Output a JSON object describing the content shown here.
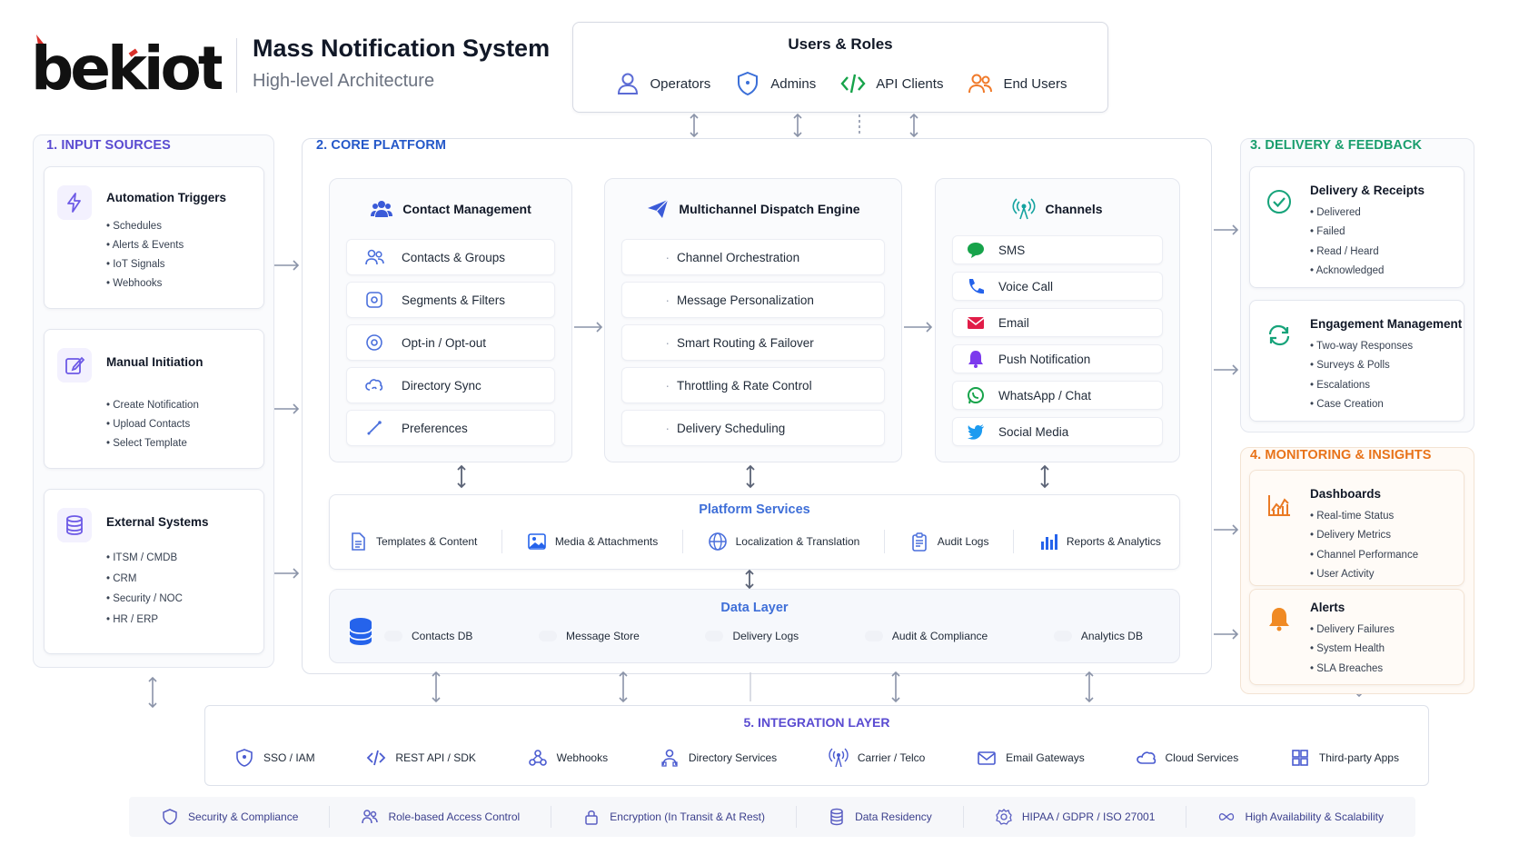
{
  "header": {
    "logo_text": "bekiot",
    "title": "Mass Notification System",
    "subtitle": "High-level Architecture"
  },
  "users_roles": {
    "title": "Users & Roles",
    "items": [
      {
        "label": "Operators",
        "icon": "user-icon"
      },
      {
        "label": "Admins",
        "icon": "shield-icon"
      },
      {
        "label": "API Clients",
        "icon": "code-icon"
      },
      {
        "label": "End Users",
        "icon": "users-icon"
      }
    ]
  },
  "input_sources": {
    "title": "1. INPUT SOURCES",
    "cards": [
      {
        "title": "Automation Triggers",
        "icon": "lightning-icon",
        "items": [
          "Schedules",
          "Alerts & Events",
          "IoT Signals",
          "Webhooks"
        ]
      },
      {
        "title": "Manual Initiation",
        "icon": "edit-icon",
        "items": [
          "Create Notification",
          "Upload Contacts",
          "Select Template"
        ]
      },
      {
        "title": "External Systems",
        "icon": "database-icon",
        "items": [
          "ITSM / CMDB",
          "CRM",
          "Security / NOC",
          "HR / ERP"
        ]
      }
    ]
  },
  "core_platform": {
    "title": "2. CORE PLATFORM",
    "contact_management": {
      "title": "Contact Management",
      "items": [
        "Contacts & Groups",
        "Segments & Filters",
        "Opt-in / Opt-out",
        "Directory Sync",
        "Preferences"
      ]
    },
    "dispatch_engine": {
      "title": "Multichannel Dispatch Engine",
      "items": [
        "Channel Orchestration",
        "Message Personalization",
        "Smart Routing & Failover",
        "Throttling & Rate Control",
        "Delivery Scheduling"
      ]
    },
    "channels": {
      "title": "Channels",
      "items": [
        {
          "label": "SMS",
          "icon": "chat-bubble-icon",
          "color": "#16a34a"
        },
        {
          "label": "Voice Call",
          "icon": "phone-icon",
          "color": "#2563eb"
        },
        {
          "label": "Email",
          "icon": "mail-icon",
          "color": "#e11d48"
        },
        {
          "label": "Push Notification",
          "icon": "bell-icon",
          "color": "#7c3aed"
        },
        {
          "label": "WhatsApp / Chat",
          "icon": "whatsapp-icon",
          "color": "#16a34a"
        },
        {
          "label": "Social Media",
          "icon": "twitter-icon",
          "color": "#1d9bf0"
        }
      ]
    },
    "platform_services": {
      "title": "Platform Services",
      "items": [
        "Templates & Content",
        "Media & Attachments",
        "Localization & Translation",
        "Audit Logs",
        "Reports & Analytics"
      ]
    },
    "data_layer": {
      "title": "Data Layer",
      "items": [
        "Contacts DB",
        "Message Store",
        "Delivery Logs",
        "Audit & Compliance",
        "Analytics DB"
      ]
    }
  },
  "delivery_feedback": {
    "title": "3. DELIVERY & FEEDBACK",
    "cards": [
      {
        "title": "Delivery & Receipts",
        "icon": "check-circle-icon",
        "items": [
          "Delivered",
          "Failed",
          "Read / Heard",
          "Acknowledged"
        ]
      },
      {
        "title": "Engagement Management",
        "icon": "refresh-icon",
        "items": [
          "Two-way Responses",
          "Surveys & Polls",
          "Escalations",
          "Case Creation"
        ]
      }
    ]
  },
  "monitoring": {
    "title": "4. MONITORING & INSIGHTS",
    "cards": [
      {
        "title": "Dashboards",
        "icon": "line-chart-icon",
        "items": [
          "Real-time Status",
          "Delivery Metrics",
          "Channel Performance",
          "User Activity"
        ]
      },
      {
        "title": "Alerts",
        "icon": "bell-icon",
        "items": [
          "Delivery Failures",
          "System Health",
          "SLA Breaches"
        ]
      }
    ]
  },
  "integration": {
    "title": "5. INTEGRATION LAYER",
    "items": [
      "SSO / IAM",
      "REST API / SDK",
      "Webhooks",
      "Directory Services",
      "Carrier / Telco",
      "Email Gateways",
      "Cloud Services",
      "Third-party Apps"
    ]
  },
  "footer": {
    "items": [
      "Security & Compliance",
      "Role-based Access Control",
      "Encryption (In Transit & At Rest)",
      "Data Residency",
      "HIPAA / GDPR / ISO 27001",
      "High Availability & Scalability"
    ]
  },
  "colors": {
    "blue": "#2458c9",
    "teal": "#1a9e6d",
    "orange": "#e8731a",
    "purple": "#5a4bd1"
  }
}
